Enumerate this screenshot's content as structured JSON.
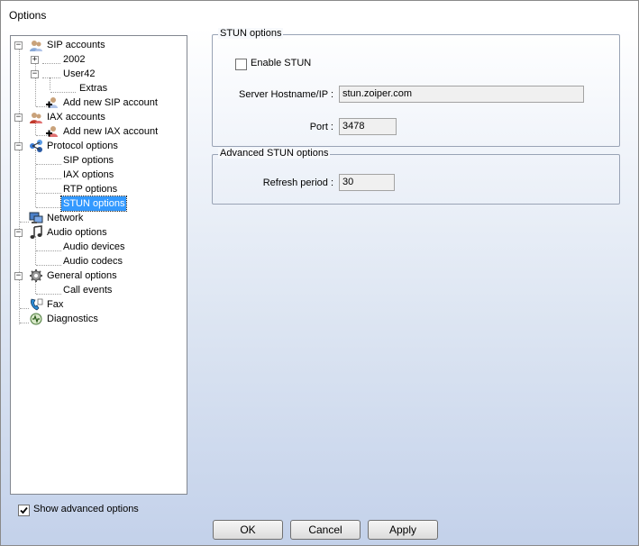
{
  "window": {
    "title": "Options"
  },
  "tree": {
    "items": [
      {
        "label": "SIP accounts",
        "icon": "sip-accounts-icon",
        "expander": "−"
      },
      {
        "label": "2002",
        "expander": "+"
      },
      {
        "label": "User42",
        "expander": "−"
      },
      {
        "label": "Extras"
      },
      {
        "label": "Add new SIP account",
        "icon": "add-account-icon"
      },
      {
        "label": "IAX accounts",
        "icon": "iax-accounts-icon",
        "expander": "−"
      },
      {
        "label": "Add new IAX account",
        "icon": "add-account-icon"
      },
      {
        "label": "Protocol options",
        "icon": "protocol-icon",
        "expander": "−"
      },
      {
        "label": "SIP options"
      },
      {
        "label": "IAX options"
      },
      {
        "label": "RTP options"
      },
      {
        "label": "STUN options",
        "selected": true
      },
      {
        "label": "Network",
        "icon": "network-icon"
      },
      {
        "label": "Audio options",
        "icon": "music-note-icon",
        "expander": "−"
      },
      {
        "label": "Audio devices"
      },
      {
        "label": "Audio codecs"
      },
      {
        "label": "General options",
        "icon": "gear-icon",
        "expander": "−"
      },
      {
        "label": "Call events"
      },
      {
        "label": "Fax",
        "icon": "fax-icon"
      },
      {
        "label": "Diagnostics",
        "icon": "diagnostics-icon"
      }
    ]
  },
  "stun": {
    "group_title": "STUN options",
    "enable_label": "Enable STUN",
    "enable_checked": false,
    "server_label": "Server Hostname/IP :",
    "server_value": "stun.zoiper.com",
    "port_label": "Port :",
    "port_value": "3478"
  },
  "advanced": {
    "group_title": "Advanced STUN options",
    "refresh_label": "Refresh period :",
    "refresh_value": "30"
  },
  "footer": {
    "show_advanced_label": "Show advanced options",
    "show_advanced_checked": true,
    "ok_label": "OK",
    "cancel_label": "Cancel",
    "apply_label": "Apply"
  }
}
